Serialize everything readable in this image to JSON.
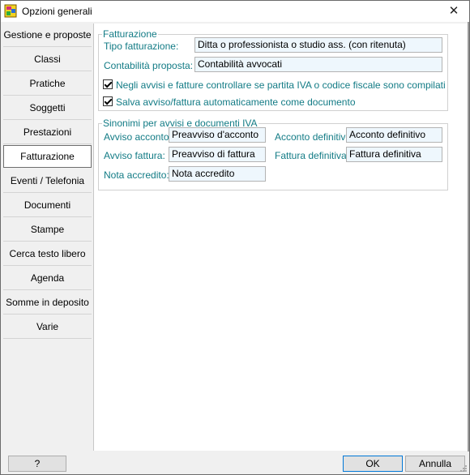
{
  "window": {
    "title": "Opzioni generali",
    "close_icon": "close-icon"
  },
  "sidebar": {
    "items": [
      {
        "label": "Gestione e proposte"
      },
      {
        "label": "Classi"
      },
      {
        "label": "Pratiche"
      },
      {
        "label": "Soggetti"
      },
      {
        "label": "Prestazioni"
      },
      {
        "label": "Fatturazione",
        "active": true
      },
      {
        "label": "Eventi / Telefonia"
      },
      {
        "label": "Documenti"
      },
      {
        "label": "Stampe"
      },
      {
        "label": "Cerca testo libero"
      },
      {
        "label": "Agenda"
      },
      {
        "label": "Somme in deposito"
      },
      {
        "label": "Varie"
      }
    ]
  },
  "fatturazione": {
    "group_title": "Fatturazione",
    "tipo_label": "Tipo fatturazione:",
    "tipo_value": "Ditta o professionista o studio ass. (con ritenuta)",
    "contabilita_label": "Contabilità proposta:",
    "contabilita_value": "Contabilità avvocati",
    "check1_label": "Negli avvisi e fatture controllare se partita IVA o codice fiscale sono compilati",
    "check1_checked": true,
    "check2_label": "Salva avviso/fattura automaticamente come documento",
    "check2_checked": true
  },
  "sinonimi": {
    "group_title": "Sinonimi per avvisi e documenti IVA",
    "avviso_acconto_label": "Avviso acconto:",
    "avviso_acconto_value": "Preavviso d'acconto",
    "acconto_definitivo_label": "Acconto definitivo",
    "acconto_definitivo_value": "Acconto definitivo",
    "avviso_fattura_label": "Avviso fattura:",
    "avviso_fattura_value": "Preavviso di fattura",
    "fattura_definitiva_label": "Fattura definitiva:",
    "fattura_definitiva_value": "Fattura definitiva",
    "nota_accredito_label": "Nota accredito:",
    "nota_accredito_value": "Nota accredito"
  },
  "footer": {
    "help_label": "?",
    "ok_label": "OK",
    "cancel_label": "Annulla"
  },
  "colors": {
    "label_teal": "#127b85",
    "field_bg": "#eef7fd",
    "ok_border": "#0078d7"
  }
}
